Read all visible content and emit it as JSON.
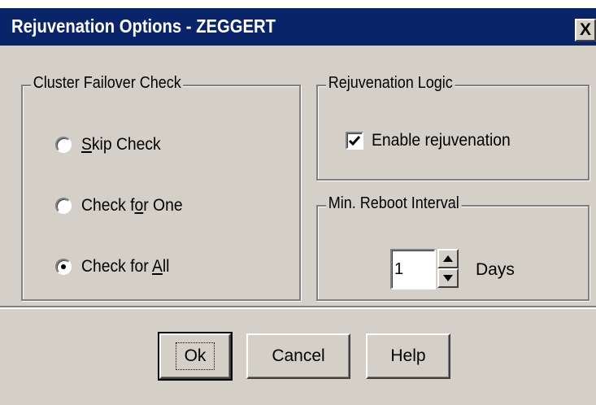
{
  "window": {
    "title": "Rejuvenation Options - ZEGGERT",
    "close_label": "X"
  },
  "cluster_failover": {
    "legend": "Cluster Failover Check",
    "options": [
      {
        "label_pre": "",
        "label_ul": "S",
        "label_post": "kip Check",
        "selected": false
      },
      {
        "label_pre": "Check f",
        "label_ul": "o",
        "label_post": "r One",
        "selected": false
      },
      {
        "label_pre": "Check for ",
        "label_ul": "A",
        "label_post": "ll",
        "selected": true
      }
    ]
  },
  "rejuvenation_logic": {
    "legend": "Rejuvenation Logic",
    "checkbox_label": "Enable rejuvenation",
    "checked": true
  },
  "reboot_interval": {
    "legend": "Min. Reboot Interval",
    "value": "1",
    "unit": "Days"
  },
  "buttons": {
    "ok": "Ok",
    "cancel": "Cancel",
    "help": "Help"
  },
  "colors": {
    "titlebar": "#0a246a",
    "face": "#d4d0c8"
  }
}
